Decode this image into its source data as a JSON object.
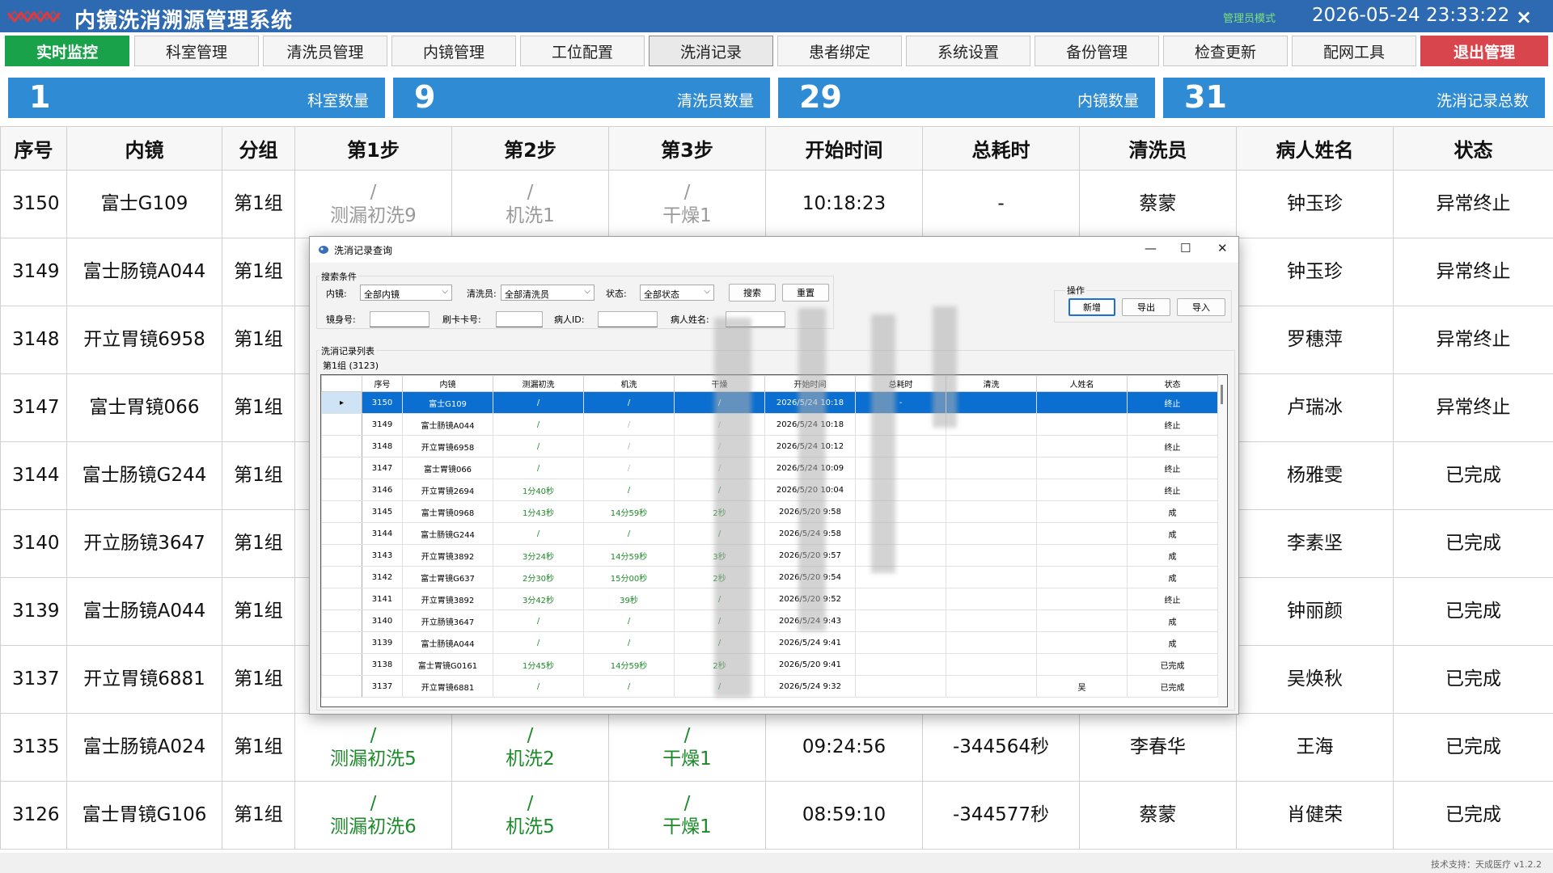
{
  "app": {
    "title": "内镜洗消溯源管理系统",
    "mode": "管理员模式",
    "datetime": "2026-05-24 23:33:22",
    "close": "×",
    "footer": "技术支持：天成医疗 v1.2.2"
  },
  "nav": [
    {
      "label": "实时监控"
    },
    {
      "label": "科室管理"
    },
    {
      "label": "清洗员管理"
    },
    {
      "label": "内镜管理"
    },
    {
      "label": "工位配置"
    },
    {
      "label": "洗消记录"
    },
    {
      "label": "患者绑定"
    },
    {
      "label": "系统设置"
    },
    {
      "label": "备份管理"
    },
    {
      "label": "检查更新"
    },
    {
      "label": "配网工具"
    },
    {
      "label": "退出管理"
    }
  ],
  "stats": [
    {
      "value": "1",
      "label": "科室数量"
    },
    {
      "value": "9",
      "label": "清洗员数量"
    },
    {
      "value": "29",
      "label": "内镜数量"
    },
    {
      "value": "31",
      "label": "洗消记录总数"
    }
  ],
  "main_table": {
    "headers": [
      "序号",
      "内镜",
      "分组",
      "第1步",
      "第2步",
      "第3步",
      "开始时间",
      "总耗时",
      "清洗员",
      "病人姓名",
      "状态"
    ],
    "rows": [
      {
        "id": "3150",
        "scope": "富士G109",
        "group": "第1组",
        "s1": "/",
        "s1n": "测漏初洗9",
        "s2": "/",
        "s2n": "机洗1",
        "s3": "/",
        "s3n": "干燥1",
        "start": "10:18:23",
        "total": "-",
        "washer": "蔡蒙",
        "patient": "钟玉珍",
        "status": "异常终止",
        "color": "gray"
      },
      {
        "id": "3149",
        "scope": "富士肠镜A044",
        "group": "第1组",
        "s1": "",
        "s1n": "",
        "s2": "",
        "s2n": "",
        "s3": "",
        "s3n": "",
        "start": "",
        "total": "",
        "washer": "",
        "patient": "钟玉珍",
        "status": "异常终止",
        "color": "gray"
      },
      {
        "id": "3148",
        "scope": "开立胃镜6958",
        "group": "第1组",
        "s1": "",
        "s1n": "",
        "s2": "",
        "s2n": "",
        "s3": "",
        "s3n": "",
        "start": "",
        "total": "",
        "washer": "",
        "patient": "罗穗萍",
        "status": "异常终止",
        "color": "gray"
      },
      {
        "id": "3147",
        "scope": "富士胃镜066",
        "group": "第1组",
        "s1": "",
        "s1n": "",
        "s2": "",
        "s2n": "",
        "s3": "",
        "s3n": "",
        "start": "",
        "total": "",
        "washer": "",
        "patient": "卢瑞冰",
        "status": "异常终止",
        "color": "gray"
      },
      {
        "id": "3144",
        "scope": "富士肠镜G244",
        "group": "第1组",
        "s1": "",
        "s1n": "",
        "s2": "",
        "s2n": "",
        "s3": "",
        "s3n": "",
        "start": "",
        "total": "",
        "washer": "",
        "patient": "杨雅雯",
        "status": "已完成",
        "color": "green"
      },
      {
        "id": "3140",
        "scope": "开立肠镜3647",
        "group": "第1组",
        "s1": "",
        "s1n": "",
        "s2": "",
        "s2n": "",
        "s3": "",
        "s3n": "",
        "start": "",
        "total": "",
        "washer": "",
        "patient": "李素坚",
        "status": "已完成",
        "color": "green"
      },
      {
        "id": "3139",
        "scope": "富士肠镜A044",
        "group": "第1组",
        "s1": "",
        "s1n": "",
        "s2": "",
        "s2n": "",
        "s3": "",
        "s3n": "",
        "start": "",
        "total": "",
        "washer": "",
        "patient": "钟丽颜",
        "status": "已完成",
        "color": "green"
      },
      {
        "id": "3137",
        "scope": "开立胃镜6881",
        "group": "第1组",
        "s1": "",
        "s1n": "",
        "s2": "",
        "s2n": "",
        "s3": "",
        "s3n": "",
        "start": "",
        "total": "",
        "washer": "",
        "patient": "吴焕秋",
        "status": "已完成",
        "color": "green"
      },
      {
        "id": "3135",
        "scope": "富士肠镜A024",
        "group": "第1组",
        "s1": "/",
        "s1n": "测漏初洗5",
        "s2": "/",
        "s2n": "机洗2",
        "s3": "/",
        "s3n": "干燥1",
        "start": "09:24:56",
        "total": "-344564秒",
        "washer": "李春华",
        "patient": "王海",
        "status": "已完成",
        "color": "green"
      },
      {
        "id": "3126",
        "scope": "富士胃镜G106",
        "group": "第1组",
        "s1": "/",
        "s1n": "测漏初洗6",
        "s2": "/",
        "s2n": "机洗5",
        "s3": "/",
        "s3n": "干燥1",
        "start": "08:59:10",
        "total": "-344577秒",
        "washer": "蔡蒙",
        "patient": "肖健荣",
        "status": "已完成",
        "color": "green"
      }
    ]
  },
  "dialog": {
    "title": "洗消记录查询",
    "controls": {
      "minimize": "—",
      "maximize": "☐",
      "close": "✕"
    },
    "search_legend": "搜索条件",
    "scope_label": "内镜:",
    "scope_value": "全部内镜",
    "washer_label": "清洗员:",
    "washer_value": "全部清洗员",
    "status_label": "状态:",
    "status_value": "全部状态",
    "search_btn": "搜索",
    "reset_btn": "重置",
    "scope_no_label": "镜身号:",
    "card_label": "刷卡卡号:",
    "patient_id_label": "病人ID:",
    "patient_name_label": "病人姓名:",
    "ops_legend": "操作",
    "add_btn": "新增",
    "export_btn": "导出",
    "import_btn": "导入",
    "list_legend": "洗消记录列表",
    "group_caption": "第1组 (3123)",
    "grid_headers": [
      "序号",
      "内镜",
      "测漏初洗",
      "机洗",
      "干燥",
      "开始时间",
      "总耗时",
      "清洗",
      "人姓名",
      "状态"
    ],
    "grid_rows": [
      {
        "id": "3150",
        "scope": "富士G109",
        "a": "/",
        "b": "/",
        "c": "/",
        "start": "2026/5/24 10:18",
        "total": "-",
        "washer": "",
        "patient": "",
        "status": "终止",
        "tone": "sel"
      },
      {
        "id": "3149",
        "scope": "富士肠镜A044",
        "a": "/",
        "b": "/",
        "c": "/",
        "start": "2026/5/24 10:18",
        "total": "",
        "washer": "",
        "patient": "",
        "status": "终止",
        "tone": "lg"
      },
      {
        "id": "3148",
        "scope": "开立胃镜6958",
        "a": "/",
        "b": "/",
        "c": "/",
        "start": "2026/5/24 10:12",
        "total": "",
        "washer": "",
        "patient": "",
        "status": "终止",
        "tone": "lg"
      },
      {
        "id": "3147",
        "scope": "富士胃镜066",
        "a": "/",
        "b": "/",
        "c": "/",
        "start": "2026/5/24 10:09",
        "total": "",
        "washer": "",
        "patient": "",
        "status": "终止",
        "tone": "lg"
      },
      {
        "id": "3146",
        "scope": "开立胃镜2694",
        "a": "1分40秒",
        "b": "/",
        "c": "/",
        "start": "2026/5/20 10:04",
        "total": "",
        "washer": "",
        "patient": "",
        "status": "终止",
        "tone": "g"
      },
      {
        "id": "3145",
        "scope": "富士胃镜0968",
        "a": "1分43秒",
        "b": "14分59秒",
        "c": "2秒",
        "start": "2026/5/20 9:58",
        "total": "",
        "washer": "",
        "patient": "",
        "status": "成",
        "tone": "g"
      },
      {
        "id": "3144",
        "scope": "富士肠镜G244",
        "a": "/",
        "b": "/",
        "c": "/",
        "start": "2026/5/24 9:58",
        "total": "",
        "washer": "",
        "patient": "",
        "status": "成",
        "tone": "g"
      },
      {
        "id": "3143",
        "scope": "开立胃镜3892",
        "a": "3分24秒",
        "b": "14分59秒",
        "c": "3秒",
        "start": "2026/5/20 9:57",
        "total": "",
        "washer": "",
        "patient": "",
        "status": "成",
        "tone": "g"
      },
      {
        "id": "3142",
        "scope": "富士胃镜G637",
        "a": "2分30秒",
        "b": "15分00秒",
        "c": "2秒",
        "start": "2026/5/20 9:54",
        "total": "",
        "washer": "",
        "patient": "",
        "status": "成",
        "tone": "g"
      },
      {
        "id": "3141",
        "scope": "开立胃镜3892",
        "a": "3分42秒",
        "b": "39秒",
        "c": "/",
        "start": "2026/5/20 9:52",
        "total": "",
        "washer": "",
        "patient": "",
        "status": "终止",
        "tone": "g"
      },
      {
        "id": "3140",
        "scope": "开立肠镜3647",
        "a": "/",
        "b": "/",
        "c": "/",
        "start": "2026/5/24 9:43",
        "total": "",
        "washer": "",
        "patient": "",
        "status": "成",
        "tone": "g"
      },
      {
        "id": "3139",
        "scope": "富士肠镜A044",
        "a": "/",
        "b": "/",
        "c": "/",
        "start": "2026/5/24 9:41",
        "total": "",
        "washer": "",
        "patient": "",
        "status": "成",
        "tone": "g"
      },
      {
        "id": "3138",
        "scope": "富士胃镜G0161",
        "a": "1分45秒",
        "b": "14分59秒",
        "c": "2秒",
        "start": "2026/5/20 9:41",
        "total": "",
        "washer": "",
        "patient": "",
        "status": "已完成",
        "tone": "g"
      },
      {
        "id": "3137",
        "scope": "开立胃镜6881",
        "a": "/",
        "b": "/",
        "c": "/",
        "start": "2026/5/24 9:32",
        "total": "",
        "washer": "",
        "patient": "吴",
        "status": "已完成",
        "tone": "g"
      }
    ]
  }
}
